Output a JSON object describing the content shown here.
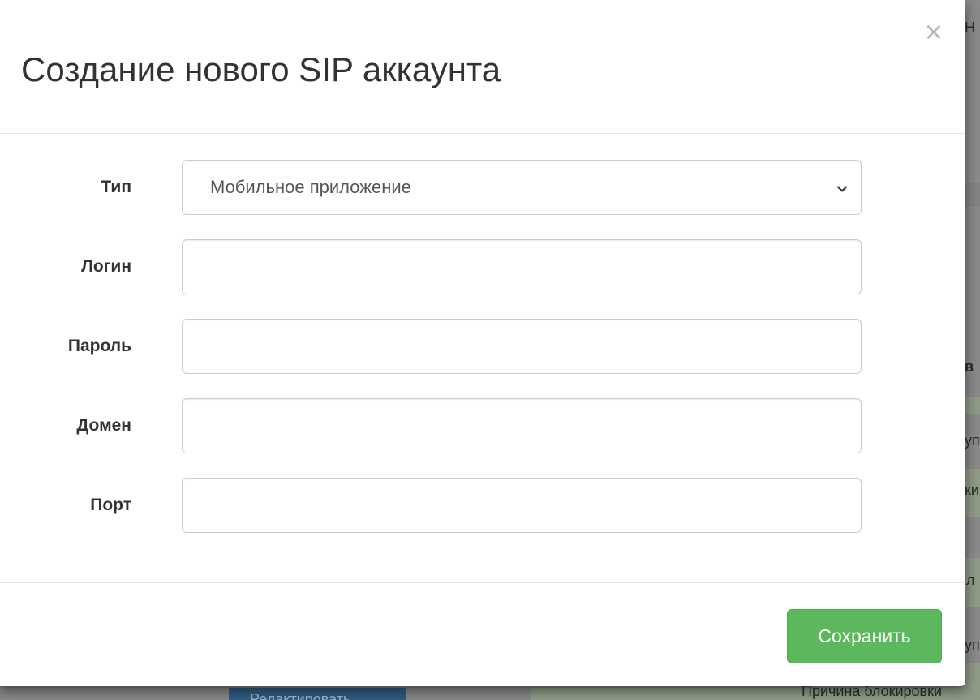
{
  "modal": {
    "title": "Создание нового SIP аккаунта",
    "close_glyph": "×",
    "fields": {
      "type": {
        "label": "Тип",
        "value": "Мобильное приложение"
      },
      "login": {
        "label": "Логин",
        "value": "",
        "placeholder": ""
      },
      "password": {
        "label": "Пароль",
        "value": "",
        "placeholder": ""
      },
      "domain": {
        "label": "Домен",
        "value": "",
        "placeholder": ""
      },
      "port": {
        "label": "Порт",
        "value": "",
        "placeholder": ""
      }
    },
    "save_label": "Сохранить",
    "colors": {
      "save_button": "#5cb85c",
      "title_text": "#333333"
    }
  },
  "background_page": {
    "fragments": [
      "Н",
      "в",
      "уп",
      "ки",
      "л",
      "уп",
      "Причина блокировки"
    ],
    "edit_button_label": "Редактировать"
  }
}
